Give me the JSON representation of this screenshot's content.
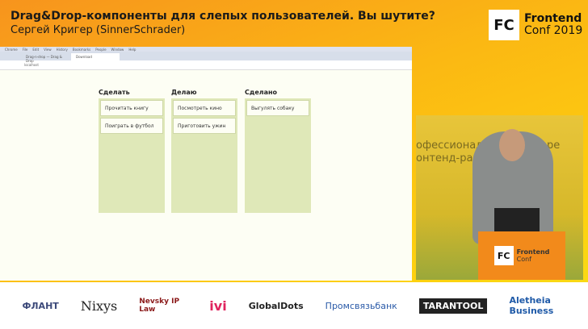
{
  "slide": {
    "title": "Drag&Drop-компоненты для слепых пользователей. Вы шутите?",
    "subtitle": "Сергей Кригер (SinnerSchrader)"
  },
  "logo": {
    "mark": "FC",
    "name": "Frontend",
    "sub": "Conf 2019"
  },
  "browser": {
    "menu": [
      "Chrome",
      "File",
      "Edit",
      "View",
      "History",
      "Bookmarks",
      "People",
      "Window",
      "Help"
    ],
    "tabs": [
      "Drag-n-drop — Drag & Drop",
      "Download"
    ],
    "url": "localhost"
  },
  "board": {
    "columns": [
      {
        "title": "Сделать",
        "cards": [
          "Прочитать книгу",
          "Поиграть в футбол"
        ]
      },
      {
        "title": "Делаю",
        "cards": [
          "Посмотреть кино",
          "Приготовить ужин"
        ]
      },
      {
        "title": "Сделано",
        "cards": [
          "Выгулять собаку"
        ]
      }
    ]
  },
  "video": {
    "backdrop_line1": "офессиональная конфере",
    "backdrop_line2": "онтенд-разработчиков",
    "podium_mark": "FC",
    "podium_name": "Frontend",
    "podium_sub": "Conf"
  },
  "sponsors": [
    "ФЛАНТ",
    "Nixys",
    "Nevsky IP Law",
    "ivi",
    "GlobalDots",
    "Промсвязьбанк",
    "TARANTOOL",
    "Aletheia Business"
  ]
}
